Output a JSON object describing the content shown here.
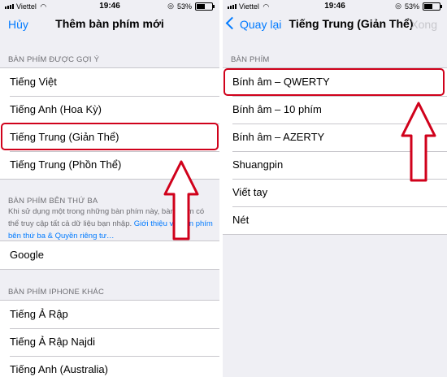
{
  "left": {
    "status": {
      "carrier": "Viettel",
      "time": "19:46",
      "battery": "53%"
    },
    "nav": {
      "cancel": "Hủy",
      "title": "Thêm bàn phím mới"
    },
    "sections": {
      "suggested_header": "BÀN PHÍM ĐƯỢC GỢI Ý",
      "suggested": [
        "Tiếng Việt",
        "Tiếng Anh (Hoa Kỳ)",
        "Tiếng Trung (Giản Thể)",
        "Tiếng Trung (Phồn Thể)"
      ],
      "third_party_header": "BÀN PHÍM BÊN THỨ BA",
      "third_party_footer": "Khi sử dụng một trong những bàn phím này, bàn phím có thể truy cập tất cả dữ liệu bạn nhập.",
      "third_party_link": "Giới thiệu về Bàn phím bên thứ ba & Quyền riêng tư…",
      "third_party": [
        "Google"
      ],
      "other_header": "BÀN PHÍM IPHONE KHÁC",
      "other": [
        "Tiếng Ả Rập",
        "Tiếng Ả Rập Najdi",
        "Tiếng Anh (Australia)"
      ]
    }
  },
  "right": {
    "status": {
      "carrier": "Viettel",
      "time": "19:46",
      "battery": "53%"
    },
    "nav": {
      "back": "Quay lại",
      "title": "Tiếng Trung (Giản Thể)",
      "done": "Xong"
    },
    "section_header": "BÀN PHÍM",
    "items": [
      "Bính âm – QWERTY",
      "Bính âm – 10 phím",
      "Bính âm – AZERTY",
      "Shuangpin",
      "Viết tay",
      "Nét"
    ]
  },
  "colors": {
    "accent": "#007aff",
    "annotation": "#d0011b",
    "background": "#efeff4"
  }
}
